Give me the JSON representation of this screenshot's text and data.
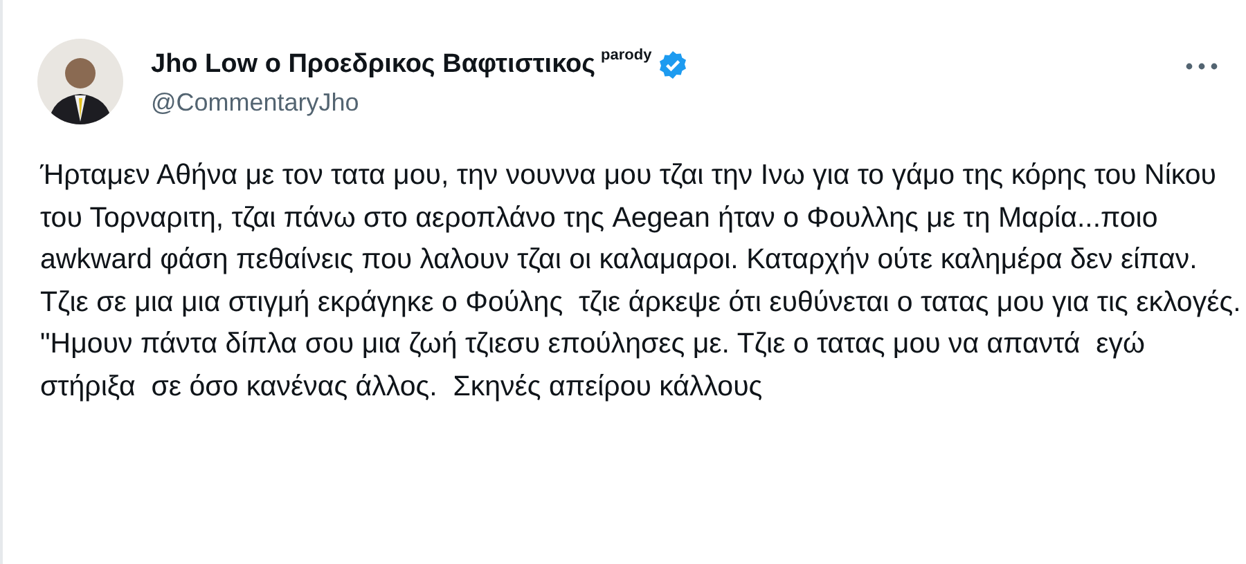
{
  "author": {
    "name": "Jho Low ο Προεδρικος Βαφτιστικος",
    "label": "parody",
    "verified": true,
    "handle": "@CommentaryJho"
  },
  "post": {
    "text": "Ήρταμεν Αθήνα με τον τατα μου, την νουννα μου τζαι την Ινω για το γάμο της κόρης του Νίκου του Τορναριτη, τζαι πάνω στο αεροπλάνο της Aegean ήταν ο Φουλλης με τη Μαρία...ποιο awkward φάση πεθαίνεις που λαλουν τζαι οι καλαμαροι. Καταρχήν ούτε καλημέρα δεν είπαν. Τζιε σε μια μια στιγμή εκράγηκε ο Φούλης  τζιε άρκεψε ότι ευθύνεται ο τατας μου για τις εκλογές. \"Ημουν πάντα δίπλα σου μια ζωή τζιεσυ επούλησες με. Τζιε ο τατας μου να απαντά  εγώ στήριξα  σε όσο κανένας άλλος.  Σκηνές απείρου κάλλους"
  }
}
